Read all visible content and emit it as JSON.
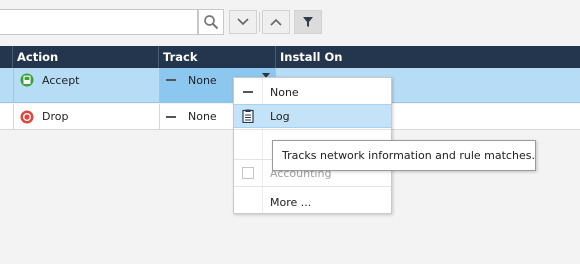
{
  "toolbar": {
    "search_value": "",
    "search_icon": "search-icon",
    "down_icon": "chevron-down-icon",
    "up_icon": "chevron-up-icon",
    "filter_icon": "filter-icon"
  },
  "table": {
    "headers": {
      "partial": "",
      "action": "Action",
      "track": "Track",
      "install_on": "Install On"
    },
    "rows": [
      {
        "action": "Accept",
        "action_icon": "accept-icon",
        "track": "None",
        "selected": true
      },
      {
        "action": "Drop",
        "action_icon": "drop-icon",
        "track": "None",
        "selected": false
      }
    ]
  },
  "track_menu": {
    "items": [
      {
        "label": "None",
        "icon": "none-dash-icon",
        "highlighted": false
      },
      {
        "label": "Log",
        "icon": "log-icon",
        "highlighted": true
      },
      {
        "label": "Accounting",
        "icon": "checkbox-icon",
        "highlighted": false
      },
      {
        "label": "More ...",
        "icon": "",
        "highlighted": false
      }
    ]
  },
  "tooltip": {
    "text": "Tracks network information and rule matches."
  },
  "colors": {
    "header_bg": "#24364d",
    "selected_row": "#b6dcf6",
    "accept": "#3aa13a",
    "drop": "#e0463d"
  }
}
